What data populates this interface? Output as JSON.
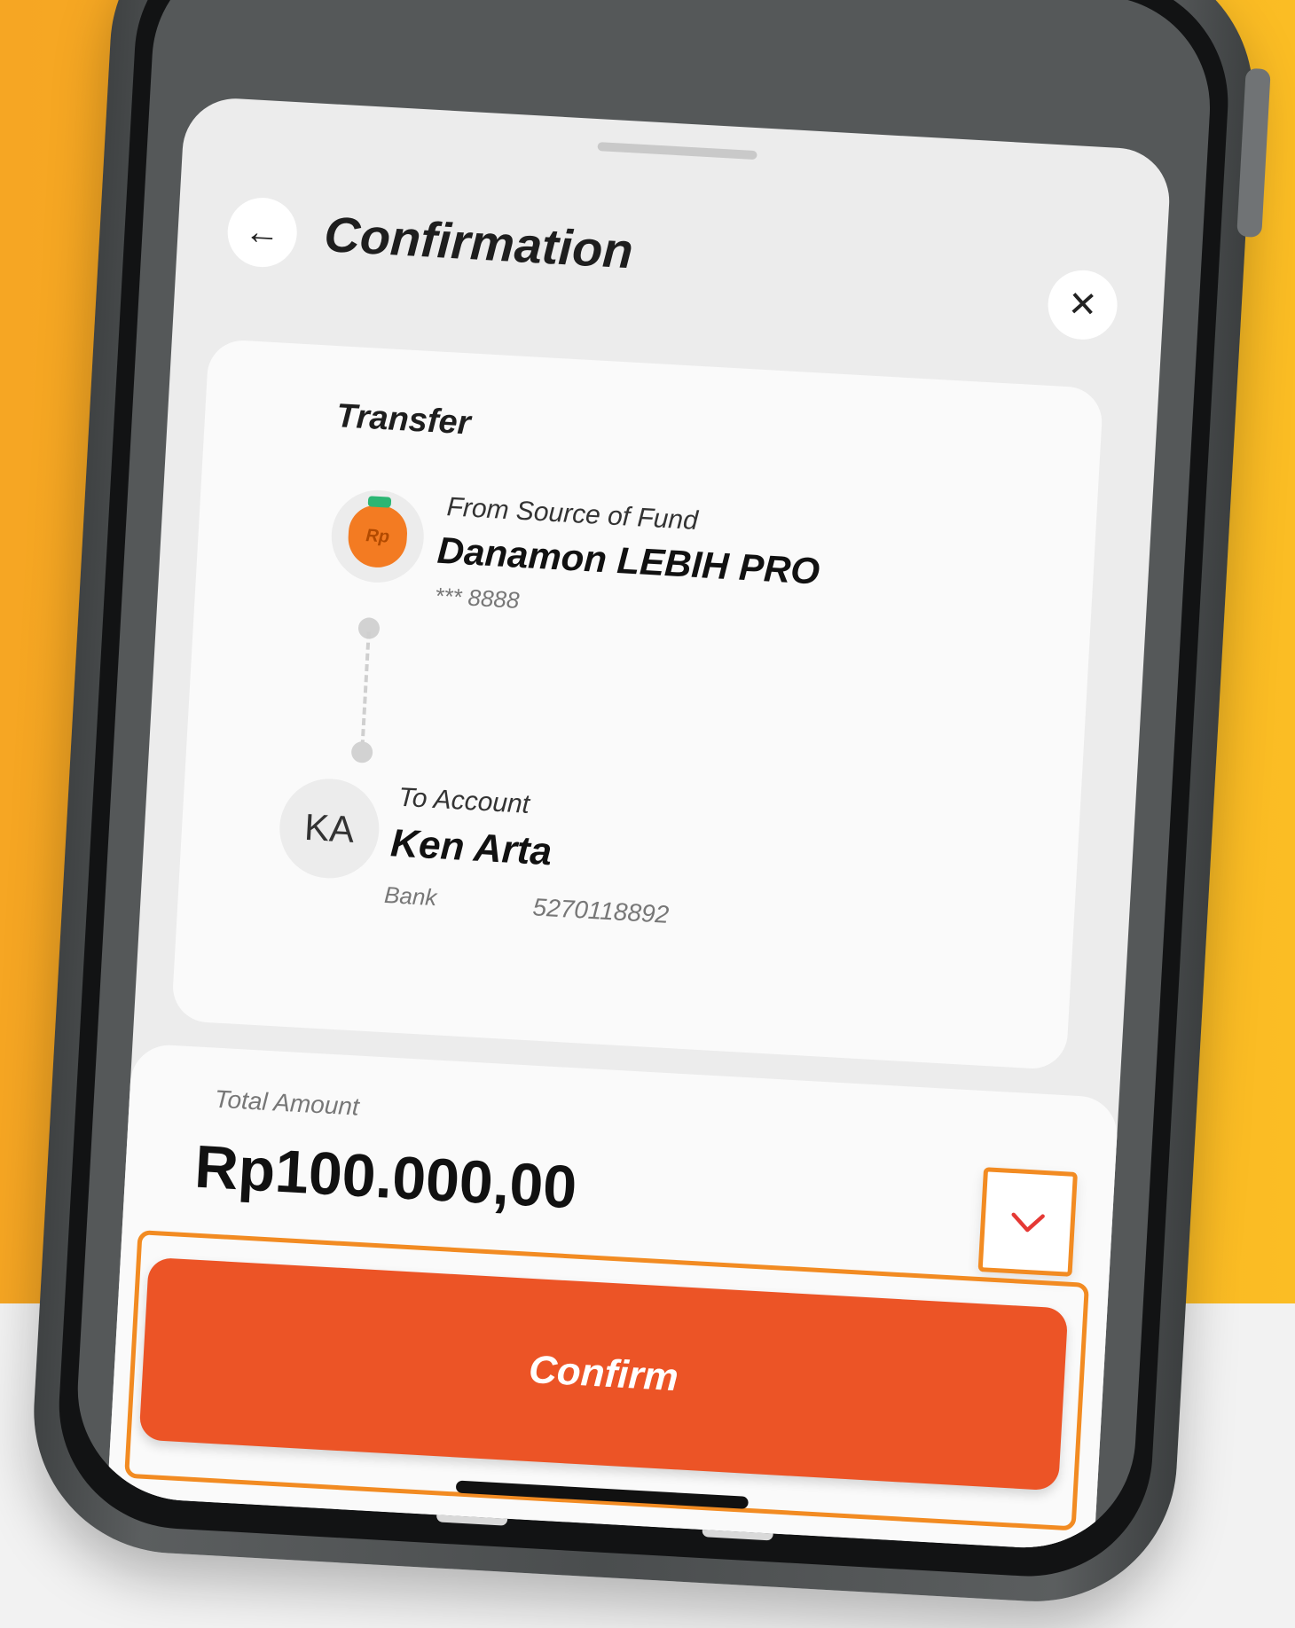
{
  "header": {
    "title": "Confirmation",
    "back_icon": "←",
    "close_icon": "✕"
  },
  "transfer": {
    "section_title": "Transfer",
    "from": {
      "label": "From Source of Fund",
      "name": "Danamon LEBIH PRO",
      "account": "*** 8888",
      "icon_text": "Rp"
    },
    "to": {
      "initials": "KA",
      "label": "To Account",
      "name": "Ken Arta",
      "bank": "Bank",
      "account_number": "5270118892"
    }
  },
  "amount": {
    "label": "Total Amount",
    "value": "Rp100.000,00"
  },
  "actions": {
    "confirm_label": "Confirm"
  },
  "colors": {
    "background_orange": "#f6a623",
    "confirm_button": "#ec5426",
    "highlight_outline": "#f28b22",
    "chevron": "#e53935"
  }
}
